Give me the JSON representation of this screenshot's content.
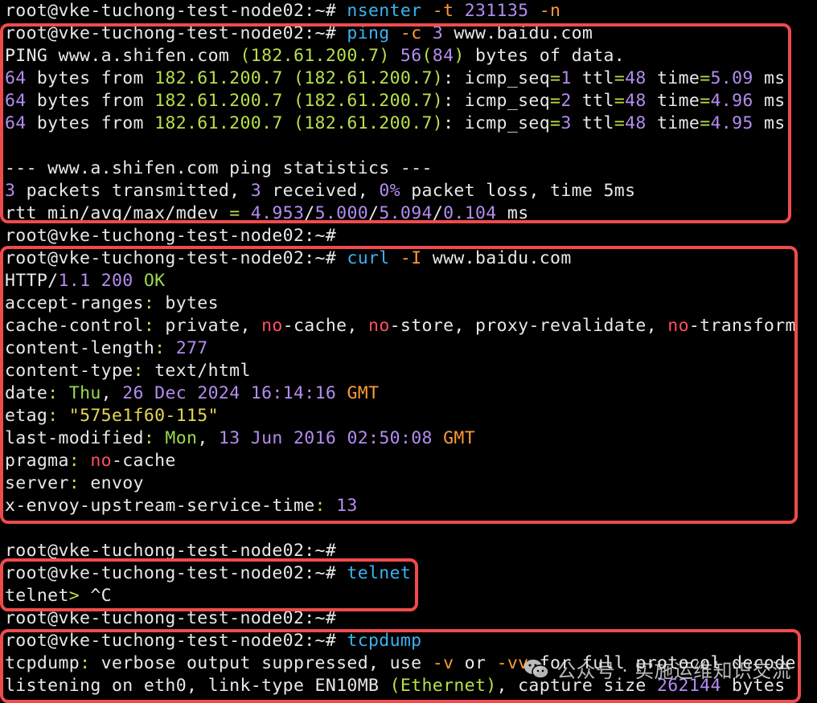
{
  "colors": {
    "text": "#e8e8e8",
    "cmd": "#3bb3f0",
    "opt": "#ff9a35",
    "num": "#b48cf0",
    "ip": "#b8e04a",
    "red": "#ff4f60",
    "str": "#e6d654",
    "date": "#e6d654",
    "orange": "#ff9a35",
    "ok": "#9bd94c",
    "highlight_box": "#ef4b4b"
  },
  "terminal": {
    "lines": [
      [
        {
          "t": "root@vke-tuchong-test-node02:~# "
        },
        {
          "t": "nsenter",
          "c": "cmd"
        },
        {
          "t": " "
        },
        {
          "t": "-t",
          "c": "opt"
        },
        {
          "t": " "
        },
        {
          "t": "231135",
          "c": "num"
        },
        {
          "t": " "
        },
        {
          "t": "-n",
          "c": "opt"
        }
      ],
      [
        {
          "t": "root@vke-tuchong-test-node02:~# "
        },
        {
          "t": "ping",
          "c": "cmd"
        },
        {
          "t": " "
        },
        {
          "t": "-c",
          "c": "opt"
        },
        {
          "t": " "
        },
        {
          "t": "3",
          "c": "num"
        },
        {
          "t": " www.baidu.com"
        }
      ],
      [
        {
          "t": "PING www.a.shifen.com "
        },
        {
          "t": "(",
          "c": "ip"
        },
        {
          "t": "182.61.200.7",
          "c": "ip"
        },
        {
          "t": ")",
          "c": "ip"
        },
        {
          "t": " "
        },
        {
          "t": "56",
          "c": "num"
        },
        {
          "t": "(",
          "c": "ip"
        },
        {
          "t": "84",
          "c": "num"
        },
        {
          "t": ")",
          "c": "ip"
        },
        {
          "t": " bytes of data."
        }
      ],
      [
        {
          "t": "64",
          "c": "num"
        },
        {
          "t": " bytes from "
        },
        {
          "t": "182.61.200.7",
          "c": "ip"
        },
        {
          "t": " "
        },
        {
          "t": "(182.61.200.7)",
          "c": "ip"
        },
        {
          "t": ": icmp_seq"
        },
        {
          "t": "=",
          "c": "ip"
        },
        {
          "t": "1",
          "c": "num"
        },
        {
          "t": " ttl"
        },
        {
          "t": "=",
          "c": "ip"
        },
        {
          "t": "48",
          "c": "num"
        },
        {
          "t": " time"
        },
        {
          "t": "=",
          "c": "ip"
        },
        {
          "t": "5.09",
          "c": "num"
        },
        {
          "t": " ms"
        }
      ],
      [
        {
          "t": "64",
          "c": "num"
        },
        {
          "t": " bytes from "
        },
        {
          "t": "182.61.200.7",
          "c": "ip"
        },
        {
          "t": " "
        },
        {
          "t": "(182.61.200.7)",
          "c": "ip"
        },
        {
          "t": ": icmp_seq"
        },
        {
          "t": "=",
          "c": "ip"
        },
        {
          "t": "2",
          "c": "num"
        },
        {
          "t": " ttl"
        },
        {
          "t": "=",
          "c": "ip"
        },
        {
          "t": "48",
          "c": "num"
        },
        {
          "t": " time"
        },
        {
          "t": "=",
          "c": "ip"
        },
        {
          "t": "4.96",
          "c": "num"
        },
        {
          "t": " ms"
        }
      ],
      [
        {
          "t": "64",
          "c": "num"
        },
        {
          "t": " bytes from "
        },
        {
          "t": "182.61.200.7",
          "c": "ip"
        },
        {
          "t": " "
        },
        {
          "t": "(182.61.200.7)",
          "c": "ip"
        },
        {
          "t": ": icmp_seq"
        },
        {
          "t": "=",
          "c": "ip"
        },
        {
          "t": "3",
          "c": "num"
        },
        {
          "t": " ttl"
        },
        {
          "t": "=",
          "c": "ip"
        },
        {
          "t": "48",
          "c": "num"
        },
        {
          "t": " time"
        },
        {
          "t": "=",
          "c": "ip"
        },
        {
          "t": "4.95",
          "c": "num"
        },
        {
          "t": " ms"
        }
      ],
      [],
      [
        {
          "t": "--- www.a.shifen.com ping statistics ---"
        }
      ],
      [
        {
          "t": "3",
          "c": "num"
        },
        {
          "t": " packets transmitted, "
        },
        {
          "t": "3",
          "c": "num"
        },
        {
          "t": " received, "
        },
        {
          "t": "0%",
          "c": "num"
        },
        {
          "t": " packet loss, time 5ms"
        }
      ],
      [
        {
          "t": "rtt min/avg/max/mdev "
        },
        {
          "t": "=",
          "c": "ip"
        },
        {
          "t": " "
        },
        {
          "t": "4.953",
          "c": "num"
        },
        {
          "t": "/"
        },
        {
          "t": "5.000",
          "c": "num"
        },
        {
          "t": "/"
        },
        {
          "t": "5.094",
          "c": "num"
        },
        {
          "t": "/"
        },
        {
          "t": "0.104",
          "c": "num"
        },
        {
          "t": " ms"
        }
      ],
      [
        {
          "t": "root@vke-tuchong-test-node02:~#"
        }
      ],
      [
        {
          "t": "root@vke-tuchong-test-node02:~# "
        },
        {
          "t": "curl",
          "c": "cmd"
        },
        {
          "t": " "
        },
        {
          "t": "-I",
          "c": "opt"
        },
        {
          "t": " www.baidu.com"
        }
      ],
      [
        {
          "t": "HTTP/"
        },
        {
          "t": "1.1",
          "c": "num"
        },
        {
          "t": " "
        },
        {
          "t": "200",
          "c": "num"
        },
        {
          "t": " "
        },
        {
          "t": "OK",
          "c": "ok"
        }
      ],
      [
        {
          "t": "accept-ranges"
        },
        {
          "t": ":",
          "c": "ip"
        },
        {
          "t": " bytes"
        }
      ],
      [
        {
          "t": "cache-control"
        },
        {
          "t": ":",
          "c": "ip"
        },
        {
          "t": " private, "
        },
        {
          "t": "no",
          "c": "red"
        },
        {
          "t": "-cache, "
        },
        {
          "t": "no",
          "c": "red"
        },
        {
          "t": "-store, proxy-revalidate, "
        },
        {
          "t": "no",
          "c": "red"
        },
        {
          "t": "-transform"
        }
      ],
      [
        {
          "t": "content-length"
        },
        {
          "t": ":",
          "c": "ip"
        },
        {
          "t": " "
        },
        {
          "t": "277",
          "c": "num"
        }
      ],
      [
        {
          "t": "content-type"
        },
        {
          "t": ":",
          "c": "ip"
        },
        {
          "t": " text/html"
        }
      ],
      [
        {
          "t": "date"
        },
        {
          "t": ":",
          "c": "ip"
        },
        {
          "t": " "
        },
        {
          "t": "Thu",
          "c": "ok"
        },
        {
          "t": ", "
        },
        {
          "t": "26",
          "c": "num"
        },
        {
          "t": " "
        },
        {
          "t": "Dec",
          "c": "num"
        },
        {
          "t": " "
        },
        {
          "t": "2024",
          "c": "num"
        },
        {
          "t": " "
        },
        {
          "t": "16:14:16",
          "c": "num"
        },
        {
          "t": " "
        },
        {
          "t": "GMT",
          "c": "orange"
        }
      ],
      [
        {
          "t": "etag"
        },
        {
          "t": ":",
          "c": "ip"
        },
        {
          "t": " "
        },
        {
          "t": "\"575e1f60-115\"",
          "c": "str"
        }
      ],
      [
        {
          "t": "last-modified"
        },
        {
          "t": ":",
          "c": "ip"
        },
        {
          "t": " "
        },
        {
          "t": "Mon",
          "c": "ok"
        },
        {
          "t": ", "
        },
        {
          "t": "13",
          "c": "num"
        },
        {
          "t": " "
        },
        {
          "t": "Jun",
          "c": "num"
        },
        {
          "t": " "
        },
        {
          "t": "2016",
          "c": "num"
        },
        {
          "t": " "
        },
        {
          "t": "02:50:08",
          "c": "num"
        },
        {
          "t": " "
        },
        {
          "t": "GMT",
          "c": "orange"
        }
      ],
      [
        {
          "t": "pragma"
        },
        {
          "t": ":",
          "c": "ip"
        },
        {
          "t": " "
        },
        {
          "t": "no",
          "c": "red"
        },
        {
          "t": "-cache"
        }
      ],
      [
        {
          "t": "server"
        },
        {
          "t": ":",
          "c": "ip"
        },
        {
          "t": " envoy"
        }
      ],
      [
        {
          "t": "x-envoy-upstream-service-time"
        },
        {
          "t": ":",
          "c": "ip"
        },
        {
          "t": " "
        },
        {
          "t": "13",
          "c": "num"
        }
      ],
      [],
      [
        {
          "t": "root@vke-tuchong-test-node02:~#"
        }
      ],
      [
        {
          "t": "root@vke-tuchong-test-node02:~# "
        },
        {
          "t": "telnet",
          "c": "cmd"
        }
      ],
      [
        {
          "t": "telnet"
        },
        {
          "t": ">",
          "c": "ip"
        },
        {
          "t": " ^C"
        }
      ],
      [
        {
          "t": "root@vke-tuchong-test-node02:~#"
        }
      ],
      [
        {
          "t": "root@vke-tuchong-test-node02:~# "
        },
        {
          "t": "tcpdump",
          "c": "cmd"
        }
      ],
      [
        {
          "t": "tcpdump"
        },
        {
          "t": ":",
          "c": "ip"
        },
        {
          "t": " verbose output suppressed, use "
        },
        {
          "t": "-v",
          "c": "opt"
        },
        {
          "t": " or "
        },
        {
          "t": "-vv",
          "c": "opt"
        },
        {
          "t": " for full protocol decode"
        }
      ],
      [
        {
          "t": "listening on eth0, link-type EN10MB "
        },
        {
          "t": "(Ethernet)",
          "c": "ip"
        },
        {
          "t": ", capture size "
        },
        {
          "t": "262144",
          "c": "num"
        },
        {
          "t": " bytes"
        }
      ]
    ]
  },
  "watermark": {
    "icon": "wechat-icon",
    "text": "公众号 · 实施运维知识交流"
  }
}
